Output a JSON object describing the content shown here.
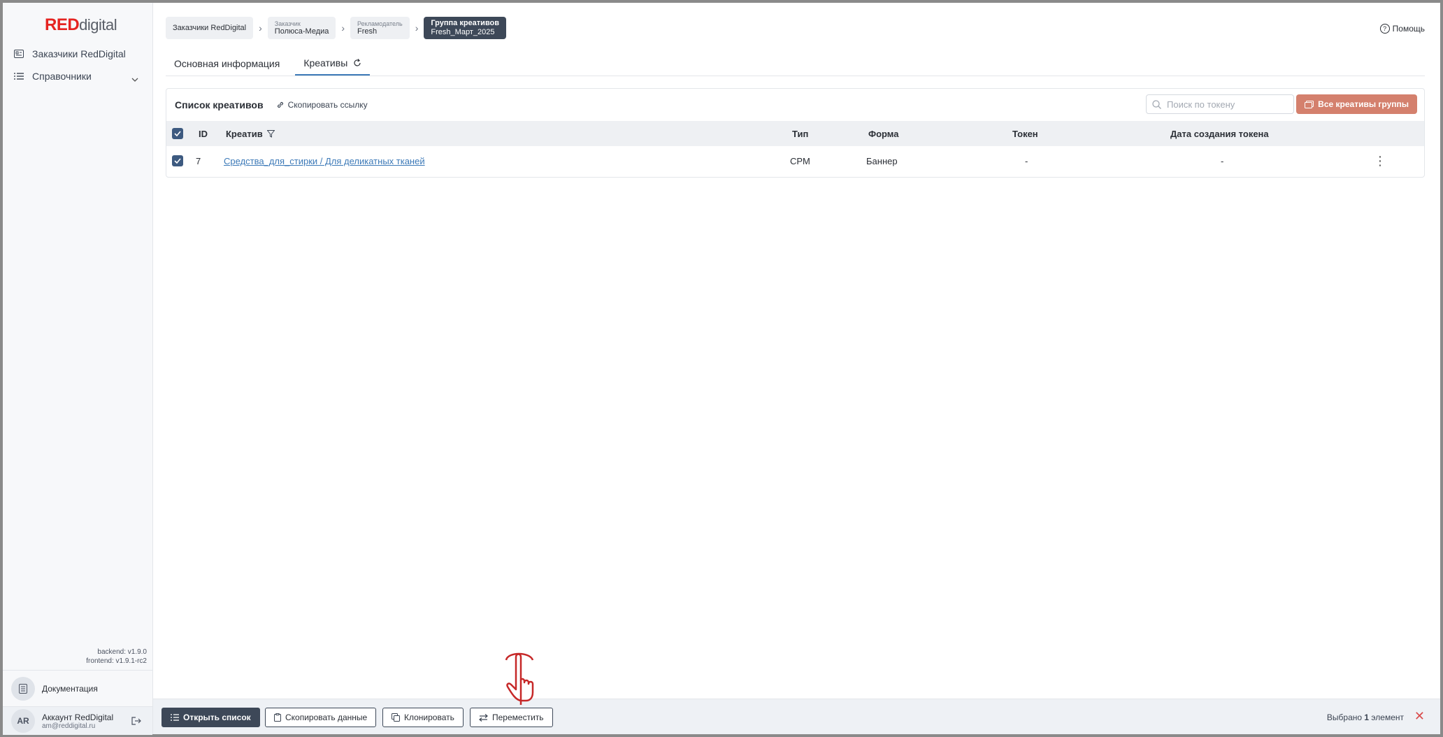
{
  "logo": {
    "red": "RED",
    "rest": "digital"
  },
  "sidebar": {
    "items": [
      {
        "label": "Заказчики RedDigital",
        "icon": "id-card-icon"
      },
      {
        "label": "Справочники",
        "icon": "list-icon"
      }
    ],
    "versions": {
      "backend": "backend: v1.9.0",
      "frontend": "frontend: v1.9.1-rc2"
    },
    "docs_label": "Документация",
    "account": {
      "initials": "AR",
      "name": "Аккаунт RedDigital",
      "email": "am@reddigital.ru"
    }
  },
  "breadcrumbs": [
    {
      "single": "Заказчики RedDigital"
    },
    {
      "small": "Заказчик",
      "big": "Полюса-Медиа"
    },
    {
      "small": "Рекламодатель",
      "big": "Fresh"
    },
    {
      "small": "Группа креативов",
      "big": "Fresh_Март_2025"
    }
  ],
  "help_label": "Помощь",
  "tabs": [
    {
      "label": "Основная информация"
    },
    {
      "label": "Креативы"
    }
  ],
  "card": {
    "title": "Список креативов",
    "copy_link": "Скопировать ссылку",
    "search_placeholder": "Поиск по токену",
    "all_button": "Все креативы группы"
  },
  "table": {
    "headers": {
      "id": "ID",
      "creative": "Креатив",
      "type": "Тип",
      "form": "Форма",
      "token": "Токен",
      "date": "Дата создания токена"
    },
    "rows": [
      {
        "id": "7",
        "creative": "Средства_для_стирки / Для деликатных тканей",
        "type": "CPM",
        "form": "Баннер",
        "token": "-",
        "date": "-"
      }
    ]
  },
  "bottom": {
    "open_list": "Открыть список",
    "copy_data": "Скопировать данные",
    "clone": "Клонировать",
    "move": "Переместить",
    "selected_prefix": "Выбрано ",
    "selected_count": "1",
    "selected_suffix": " элемент"
  },
  "colors": {
    "accent": "#e52421",
    "dark": "#3d4858",
    "button_orange": "#d4806d",
    "link": "#3d7ab8"
  }
}
